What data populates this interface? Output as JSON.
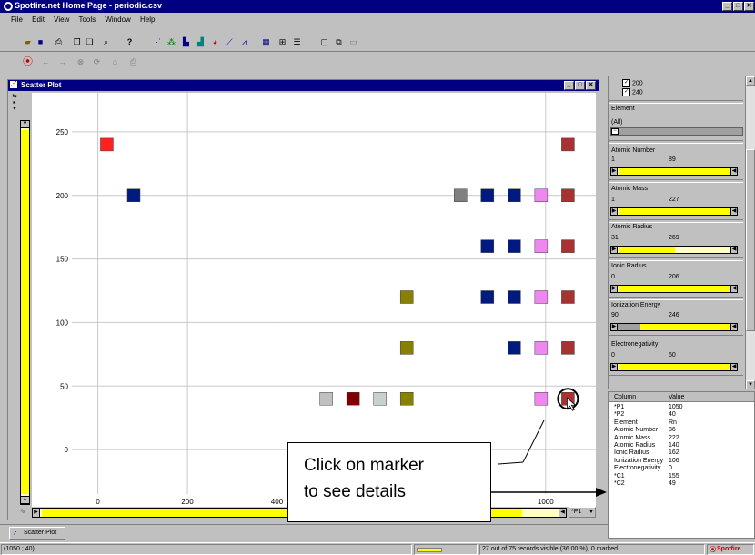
{
  "app": {
    "title": "Spotfire.net Home Page - periodic.csv"
  },
  "menu": [
    "File",
    "Edit",
    "View",
    "Tools",
    "Window",
    "Help"
  ],
  "plot_window": {
    "title": "Scatter Plot",
    "tab_label": "Scatter Plot",
    "axis_selector": "*P1"
  },
  "colors": {
    "titlebar": "#000080",
    "slider_fill": "#ffff00",
    "slider_track": "#ffffc0"
  },
  "filters": {
    "checkbox_200": "200",
    "checkbox_240": "240",
    "element": {
      "label": "Element",
      "value": "(All)"
    },
    "atomic_number": {
      "label": "Atomic Number",
      "min": "1",
      "max": "89"
    },
    "atomic_mass": {
      "label": "Atomic Mass",
      "min": "1",
      "max": "227"
    },
    "atomic_radius": {
      "label": "Atomic Radius",
      "min": "31",
      "max": "269"
    },
    "ionic_radius": {
      "label": "Ionic Radius",
      "min": "0",
      "max": "206"
    },
    "ionization_energy": {
      "label": "Ionization Energy",
      "min": "90",
      "max": "246"
    },
    "electronegativity": {
      "label": "Electronegativity",
      "min": "0",
      "max": "50"
    }
  },
  "details": {
    "headers": [
      "Column",
      "Value"
    ],
    "rows": [
      [
        "*P1",
        "1050"
      ],
      [
        "*P2",
        "40"
      ],
      [
        "Element",
        "Rn"
      ],
      [
        "Atomic Number",
        "86"
      ],
      [
        "Atomic Mass",
        "222"
      ],
      [
        "Atomic Radius",
        "140"
      ],
      [
        "Ionic Radius",
        "162"
      ],
      [
        "Ionization Energy",
        "106"
      ],
      [
        "Electronegativity",
        "0"
      ],
      [
        "*C1",
        "155"
      ],
      [
        "*C2",
        "49"
      ]
    ]
  },
  "callout": {
    "line1": "Click on marker",
    "line2": "to see details"
  },
  "status": {
    "coords": "(1050 ; 40)",
    "records": "27 out of 75 records visible (36.00 %), 0 marked",
    "logo": "Spotfire"
  },
  "chart_data": {
    "type": "scatter",
    "x_ticks": [
      "0",
      "200",
      "400",
      "1000"
    ],
    "y_ticks": [
      "250",
      "200",
      "150",
      "100",
      "50",
      "0"
    ],
    "xlim": [
      -50,
      1100
    ],
    "ylim": [
      -35,
      275
    ],
    "points": [
      {
        "x": 20,
        "y": 240,
        "color": "#ff2020"
      },
      {
        "x": 80,
        "y": 200,
        "color": "#001a80"
      },
      {
        "x": 1050,
        "y": 240,
        "color": "#a83232"
      },
      {
        "x": 810,
        "y": 200,
        "color": "#808080"
      },
      {
        "x": 870,
        "y": 200,
        "color": "#001a80"
      },
      {
        "x": 930,
        "y": 200,
        "color": "#001a80"
      },
      {
        "x": 990,
        "y": 200,
        "color": "#ee88ee"
      },
      {
        "x": 1050,
        "y": 200,
        "color": "#a83232"
      },
      {
        "x": 870,
        "y": 160,
        "color": "#001a80"
      },
      {
        "x": 930,
        "y": 160,
        "color": "#001a80"
      },
      {
        "x": 990,
        "y": 160,
        "color": "#ee88ee"
      },
      {
        "x": 1050,
        "y": 160,
        "color": "#a83232"
      },
      {
        "x": 690,
        "y": 120,
        "color": "#888000"
      },
      {
        "x": 870,
        "y": 120,
        "color": "#001a80"
      },
      {
        "x": 930,
        "y": 120,
        "color": "#001a80"
      },
      {
        "x": 990,
        "y": 120,
        "color": "#ee88ee"
      },
      {
        "x": 1050,
        "y": 120,
        "color": "#a83232"
      },
      {
        "x": 690,
        "y": 80,
        "color": "#888000"
      },
      {
        "x": 930,
        "y": 80,
        "color": "#001a80"
      },
      {
        "x": 990,
        "y": 80,
        "color": "#ee88ee"
      },
      {
        "x": 1050,
        "y": 80,
        "color": "#a83232"
      },
      {
        "x": 510,
        "y": 40,
        "color": "#c0c0c0"
      },
      {
        "x": 570,
        "y": 40,
        "color": "#800000"
      },
      {
        "x": 630,
        "y": 40,
        "color": "#c8d0d0"
      },
      {
        "x": 690,
        "y": 40,
        "color": "#888000"
      },
      {
        "x": 990,
        "y": 40,
        "color": "#ee88ee"
      },
      {
        "x": 1050,
        "y": 40,
        "color": "#a83232",
        "selected": true
      }
    ]
  }
}
